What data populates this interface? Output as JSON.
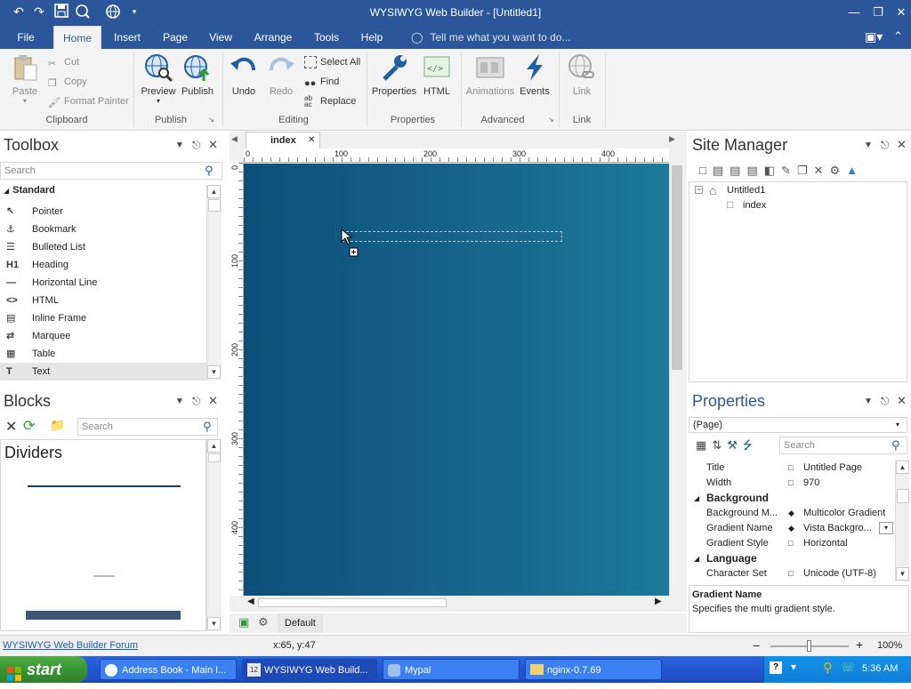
{
  "window": {
    "title": "WYSIWYG Web Builder - [Untitled1]"
  },
  "menu": {
    "tabs": [
      "File",
      "Home",
      "Insert",
      "Page",
      "View",
      "Arrange",
      "Tools",
      "Help"
    ],
    "active_tab": "Home",
    "tell_me": "Tell me what you want to do..."
  },
  "ribbon": {
    "clipboard": {
      "paste": "Paste",
      "cut": "Cut",
      "copy": "Copy",
      "format_painter": "Format Painter",
      "label": "Clipboard"
    },
    "publish": {
      "preview": "Preview",
      "publish": "Publish",
      "label": "Publish"
    },
    "editing": {
      "undo": "Undo",
      "redo": "Redo",
      "select_all": "Select All",
      "find": "Find",
      "replace": "Replace",
      "label": "Editing"
    },
    "properties": {
      "properties": "Properties",
      "html": "HTML",
      "label": "Properties"
    },
    "advanced": {
      "animations": "Animations",
      "events": "Events",
      "label": "Advanced"
    },
    "link": {
      "link": "Link",
      "label": "Link"
    }
  },
  "toolbox": {
    "title": "Toolbox",
    "search_placeholder": "Search",
    "category": "Standard",
    "items": [
      "Pointer",
      "Bookmark",
      "Bulleted List",
      "Heading",
      "Horizontal Line",
      "HTML",
      "Inline Frame",
      "Marquee",
      "Table",
      "Text"
    ]
  },
  "blocks": {
    "title": "Blocks",
    "search_placeholder": "Search",
    "category": "Dividers"
  },
  "document": {
    "tab": "index",
    "ruler_h": [
      "0",
      "100",
      "200",
      "300",
      "400"
    ],
    "ruler_v": [
      "0",
      "100",
      "200",
      "300",
      "400"
    ],
    "layer": "Default"
  },
  "site_manager": {
    "title": "Site Manager",
    "root": "Untitled1",
    "pages": [
      "index"
    ]
  },
  "properties": {
    "title": "Properties",
    "selector": "(Page)",
    "search_placeholder": "Search",
    "rows": [
      {
        "kind": "prop",
        "name": "Title",
        "value": "Untitled Page"
      },
      {
        "kind": "prop",
        "name": "Width",
        "value": "970"
      },
      {
        "kind": "cat",
        "name": "Background"
      },
      {
        "kind": "prop",
        "name": "Background M...",
        "value": "Multicolor Gradient"
      },
      {
        "kind": "prop",
        "name": "Gradient Name",
        "value": "Vista Backgro..."
      },
      {
        "kind": "prop",
        "name": "Gradient Style",
        "value": "Horizontal"
      },
      {
        "kind": "cat",
        "name": "Language"
      },
      {
        "kind": "prop",
        "name": "Character Set",
        "value": "Unicode (UTF-8)"
      }
    ],
    "help_title": "Gradient Name",
    "help_text": "Specifies the multi gradient style."
  },
  "statusbar": {
    "forum_link": "WYSIWYG Web Builder Forum",
    "coords": "x:65, y:47",
    "zoom": "100%",
    "zoom_level_fraction": 0.5
  },
  "taskbar": {
    "start": "start",
    "tasks": [
      "Address Book - Main I...",
      "WYSIWYG Web Build...",
      "Mypal",
      "nginx-0.7.69"
    ],
    "task_group_count": "12",
    "clock": "5:36 AM"
  },
  "colors": {
    "accent": "#2b579a",
    "canvas_left": "#0d4f78",
    "canvas_right": "#1d7a99",
    "taskbar": "#245edb",
    "start": "#3c9a35"
  }
}
